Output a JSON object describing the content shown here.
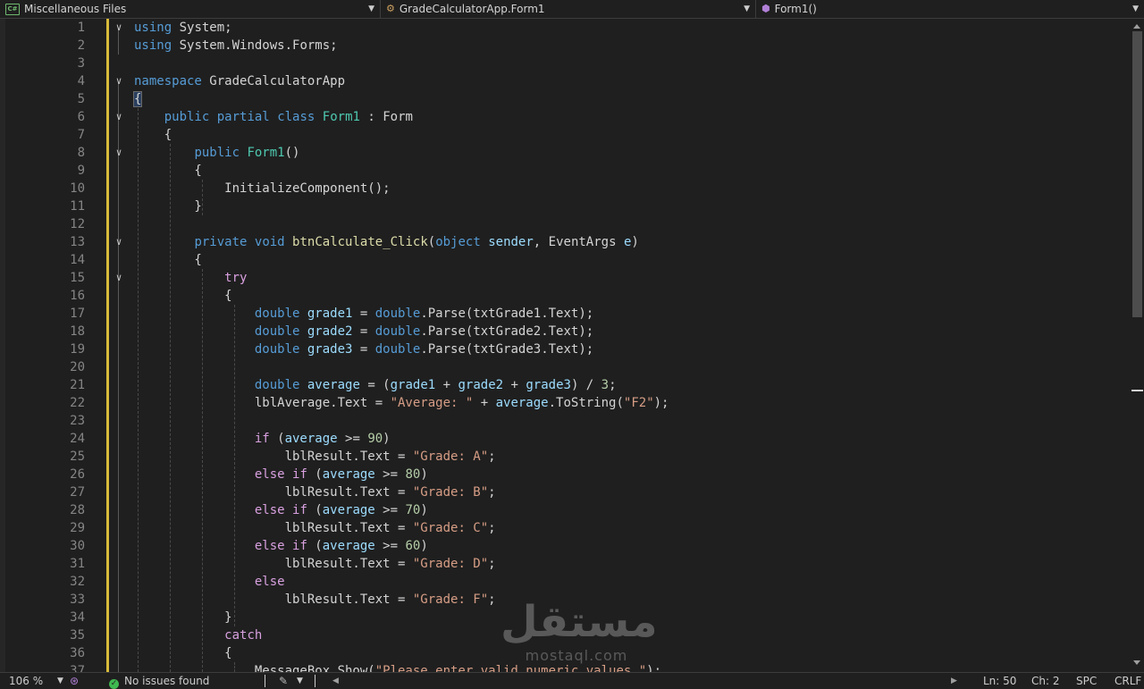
{
  "navbar": {
    "project": "Miscellaneous Files",
    "type": "GradeCalculatorApp.Form1",
    "member": "Form1()"
  },
  "code_lines": [
    {
      "n": "1",
      "t": [
        [
          "kw",
          "using"
        ],
        [
          "pl",
          " System;"
        ]
      ]
    },
    {
      "n": "2",
      "t": [
        [
          "kw",
          "using"
        ],
        [
          "pl",
          " System.Windows.Forms;"
        ]
      ]
    },
    {
      "n": "3",
      "t": []
    },
    {
      "n": "4",
      "t": [
        [
          "kw",
          "namespace"
        ],
        [
          "pl",
          " GradeCalculatorApp"
        ]
      ]
    },
    {
      "n": "5",
      "t": [
        [
          "pl",
          "{"
        ]
      ]
    },
    {
      "n": "6",
      "t": [
        [
          "pl",
          "    "
        ],
        [
          "kw",
          "public"
        ],
        [
          "pl",
          " "
        ],
        [
          "kw",
          "partial"
        ],
        [
          "pl",
          " "
        ],
        [
          "kw",
          "class"
        ],
        [
          "pl",
          " "
        ],
        [
          "ty",
          "Form1"
        ],
        [
          "pl",
          " : "
        ],
        [
          "pl",
          "Form"
        ]
      ]
    },
    {
      "n": "7",
      "t": [
        [
          "pl",
          "    {"
        ]
      ]
    },
    {
      "n": "8",
      "t": [
        [
          "pl",
          "        "
        ],
        [
          "kw",
          "public"
        ],
        [
          "pl",
          " "
        ],
        [
          "ty",
          "Form1"
        ],
        [
          "pl",
          "()"
        ]
      ]
    },
    {
      "n": "9",
      "t": [
        [
          "pl",
          "        {"
        ]
      ]
    },
    {
      "n": "10",
      "t": [
        [
          "pl",
          "            InitializeComponent();"
        ]
      ]
    },
    {
      "n": "11",
      "t": [
        [
          "pl",
          "        }"
        ]
      ]
    },
    {
      "n": "12",
      "t": []
    },
    {
      "n": "13",
      "t": [
        [
          "pl",
          "        "
        ],
        [
          "kw",
          "private"
        ],
        [
          "pl",
          " "
        ],
        [
          "kw",
          "void"
        ],
        [
          "pl",
          " "
        ],
        [
          "fn",
          "btnCalculate_Click"
        ],
        [
          "pl",
          "("
        ],
        [
          "kw",
          "object"
        ],
        [
          "pl",
          " "
        ],
        [
          "va",
          "sender"
        ],
        [
          "pl",
          ", EventArgs "
        ],
        [
          "va",
          "e"
        ],
        [
          "pl",
          ")"
        ]
      ]
    },
    {
      "n": "14",
      "t": [
        [
          "pl",
          "        {"
        ]
      ]
    },
    {
      "n": "15",
      "t": [
        [
          "pl",
          "            "
        ],
        [
          "kw2",
          "try"
        ]
      ]
    },
    {
      "n": "16",
      "t": [
        [
          "pl",
          "            {"
        ]
      ]
    },
    {
      "n": "17",
      "t": [
        [
          "pl",
          "                "
        ],
        [
          "kw",
          "double"
        ],
        [
          "pl",
          " "
        ],
        [
          "va",
          "grade1"
        ],
        [
          "pl",
          " = "
        ],
        [
          "kw",
          "double"
        ],
        [
          "pl",
          ".Parse(txtGrade1.Text);"
        ]
      ]
    },
    {
      "n": "18",
      "t": [
        [
          "pl",
          "                "
        ],
        [
          "kw",
          "double"
        ],
        [
          "pl",
          " "
        ],
        [
          "va",
          "grade2"
        ],
        [
          "pl",
          " = "
        ],
        [
          "kw",
          "double"
        ],
        [
          "pl",
          ".Parse(txtGrade2.Text);"
        ]
      ]
    },
    {
      "n": "19",
      "t": [
        [
          "pl",
          "                "
        ],
        [
          "kw",
          "double"
        ],
        [
          "pl",
          " "
        ],
        [
          "va",
          "grade3"
        ],
        [
          "pl",
          " = "
        ],
        [
          "kw",
          "double"
        ],
        [
          "pl",
          ".Parse(txtGrade3.Text);"
        ]
      ]
    },
    {
      "n": "20",
      "t": []
    },
    {
      "n": "21",
      "t": [
        [
          "pl",
          "                "
        ],
        [
          "kw",
          "double"
        ],
        [
          "pl",
          " "
        ],
        [
          "va",
          "average"
        ],
        [
          "pl",
          " = ("
        ],
        [
          "va",
          "grade1"
        ],
        [
          "pl",
          " + "
        ],
        [
          "va",
          "grade2"
        ],
        [
          "pl",
          " + "
        ],
        [
          "va",
          "grade3"
        ],
        [
          "pl",
          ") / "
        ],
        [
          "nu",
          "3"
        ],
        [
          "pl",
          ";"
        ]
      ]
    },
    {
      "n": "22",
      "t": [
        [
          "pl",
          "                lblAverage.Text = "
        ],
        [
          "st",
          "\"Average: \""
        ],
        [
          "pl",
          " + "
        ],
        [
          "va",
          "average"
        ],
        [
          "pl",
          ".ToString("
        ],
        [
          "st",
          "\"F2\""
        ],
        [
          "pl",
          ");"
        ]
      ]
    },
    {
      "n": "23",
      "t": []
    },
    {
      "n": "24",
      "t": [
        [
          "pl",
          "                "
        ],
        [
          "kw2",
          "if"
        ],
        [
          "pl",
          " ("
        ],
        [
          "va",
          "average"
        ],
        [
          "pl",
          " >= "
        ],
        [
          "nu",
          "90"
        ],
        [
          "pl",
          ")"
        ]
      ]
    },
    {
      "n": "25",
      "t": [
        [
          "pl",
          "                    lblResult.Text = "
        ],
        [
          "st",
          "\"Grade: A\""
        ],
        [
          "pl",
          ";"
        ]
      ]
    },
    {
      "n": "26",
      "t": [
        [
          "pl",
          "                "
        ],
        [
          "kw2",
          "else"
        ],
        [
          "pl",
          " "
        ],
        [
          "kw2",
          "if"
        ],
        [
          "pl",
          " ("
        ],
        [
          "va",
          "average"
        ],
        [
          "pl",
          " >= "
        ],
        [
          "nu",
          "80"
        ],
        [
          "pl",
          ")"
        ]
      ]
    },
    {
      "n": "27",
      "t": [
        [
          "pl",
          "                    lblResult.Text = "
        ],
        [
          "st",
          "\"Grade: B\""
        ],
        [
          "pl",
          ";"
        ]
      ]
    },
    {
      "n": "28",
      "t": [
        [
          "pl",
          "                "
        ],
        [
          "kw2",
          "else"
        ],
        [
          "pl",
          " "
        ],
        [
          "kw2",
          "if"
        ],
        [
          "pl",
          " ("
        ],
        [
          "va",
          "average"
        ],
        [
          "pl",
          " >= "
        ],
        [
          "nu",
          "70"
        ],
        [
          "pl",
          ")"
        ]
      ]
    },
    {
      "n": "29",
      "t": [
        [
          "pl",
          "                    lblResult.Text = "
        ],
        [
          "st",
          "\"Grade: C\""
        ],
        [
          "pl",
          ";"
        ]
      ]
    },
    {
      "n": "30",
      "t": [
        [
          "pl",
          "                "
        ],
        [
          "kw2",
          "else"
        ],
        [
          "pl",
          " "
        ],
        [
          "kw2",
          "if"
        ],
        [
          "pl",
          " ("
        ],
        [
          "va",
          "average"
        ],
        [
          "pl",
          " >= "
        ],
        [
          "nu",
          "60"
        ],
        [
          "pl",
          ")"
        ]
      ]
    },
    {
      "n": "31",
      "t": [
        [
          "pl",
          "                    lblResult.Text = "
        ],
        [
          "st",
          "\"Grade: D\""
        ],
        [
          "pl",
          ";"
        ]
      ]
    },
    {
      "n": "32",
      "t": [
        [
          "pl",
          "                "
        ],
        [
          "kw2",
          "else"
        ]
      ]
    },
    {
      "n": "33",
      "t": [
        [
          "pl",
          "                    lblResult.Text = "
        ],
        [
          "st",
          "\"Grade: F\""
        ],
        [
          "pl",
          ";"
        ]
      ]
    },
    {
      "n": "34",
      "t": [
        [
          "pl",
          "            }"
        ]
      ]
    },
    {
      "n": "35",
      "t": [
        [
          "pl",
          "            "
        ],
        [
          "kw2",
          "catch"
        ]
      ]
    },
    {
      "n": "36",
      "t": [
        [
          "pl",
          "            {"
        ]
      ]
    },
    {
      "n": "37",
      "t": [
        [
          "pl",
          "                MessageBox.Show("
        ],
        [
          "st",
          "\"Please enter valid numeric values.\""
        ],
        [
          "pl",
          ");"
        ]
      ]
    }
  ],
  "fold_lines": [
    "1",
    "4",
    "6",
    "8",
    "13",
    "15"
  ],
  "watermark": {
    "brand_arabic": "مستقل",
    "brand_latin": "mostaql.com"
  },
  "statusbar": {
    "zoom": "106 %",
    "issues": "No issues found",
    "line": "Ln: 50",
    "col": "Ch: 2",
    "indent": "SPC",
    "eol": "CRLF"
  },
  "colors": {
    "background": "#1f1f1f",
    "keyword": "#569cd6",
    "control_keyword": "#d8a0df",
    "type": "#4ec9b0",
    "method": "#dcdcaa",
    "string": "#d69d85",
    "number": "#b5cea8",
    "variable": "#9cdcfe",
    "change_bar": "#d7ba3a",
    "ok": "#3fb950"
  }
}
